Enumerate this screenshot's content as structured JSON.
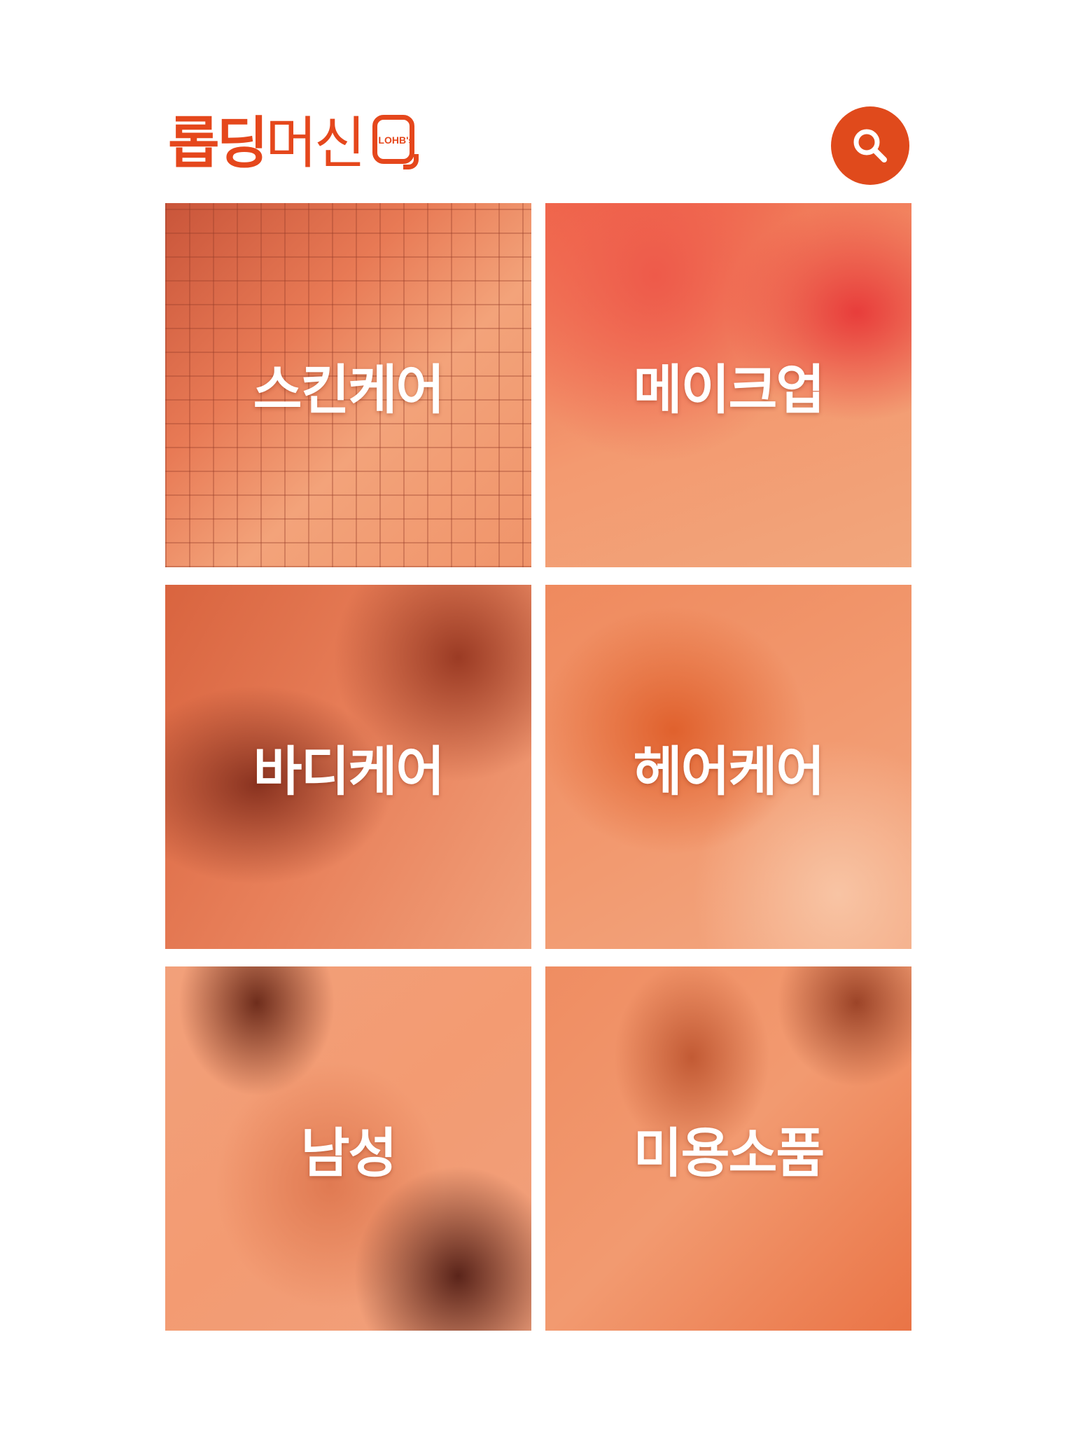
{
  "header": {
    "logo_main_bold": "롭딩",
    "logo_main_light": "머신",
    "logo_badge": "LOHB's",
    "search_icon": "search-icon"
  },
  "colors": {
    "accent": "#e5471c",
    "tile_overlay": "#f07a4a"
  },
  "categories": [
    {
      "label": "스킨케어"
    },
    {
      "label": "메이크업"
    },
    {
      "label": "바디케어"
    },
    {
      "label": "헤어케어"
    },
    {
      "label": "남성"
    },
    {
      "label": "미용소품"
    }
  ]
}
